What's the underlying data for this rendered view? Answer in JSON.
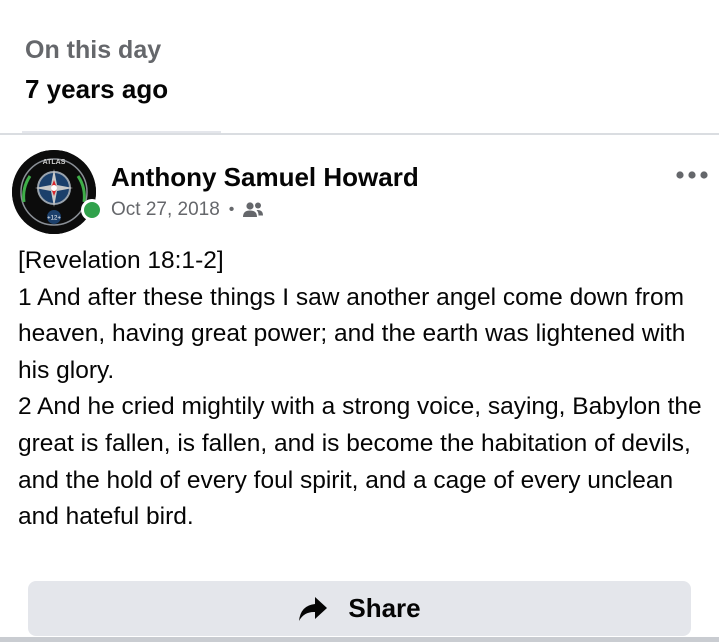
{
  "memory": {
    "label": "On this day",
    "time_ago": "7 years ago"
  },
  "post": {
    "author": "Anthony Samuel Howard",
    "date": "Oct 27, 2018",
    "separator": "•",
    "audience_icon": "friends-icon",
    "more_icon": "more-options-icon",
    "avatar_logo_text": "ATLAS",
    "avatar_badge_text": "+12+",
    "online": true,
    "lines": [
      "[Revelation 18:1-2]",
      "1 And after these things I saw another angel come down from heaven, having great power; and the earth was lightened with his glory.",
      "2 And he cried mightily with a strong voice, saying, Babylon the great is fallen, is fallen, and is become the habitation of devils, and the hold of every foul spirit, and a cage of every unclean and hateful bird."
    ]
  },
  "actions": {
    "share_label": "Share",
    "share_icon": "share-arrow-icon"
  },
  "colors": {
    "primary_text": "#050505",
    "secondary_text": "#65676b",
    "button_bg": "#e4e6eb",
    "online_green": "#31a24c",
    "divider": "#dadde1"
  }
}
